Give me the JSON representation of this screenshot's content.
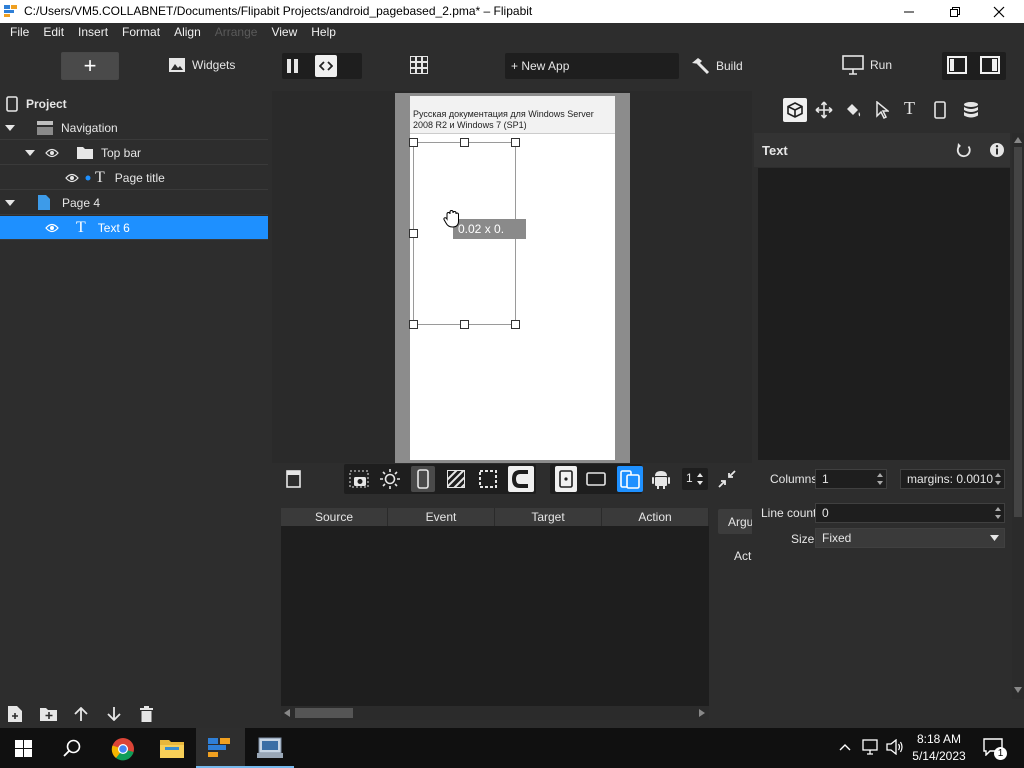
{
  "window": {
    "title": "C:/Users/VM5.COLLABNET/Documents/Flipabit Projects/android_pagebased_2.pma* – Flipabit"
  },
  "menu": [
    "File",
    "Edit",
    "Insert",
    "Format",
    "Align",
    "Arrange",
    "View",
    "Help"
  ],
  "menu_disabled": [
    "Arrange"
  ],
  "toolbar": {
    "add_label": "+",
    "widgets_label": "Widgets",
    "new_app_label": "+ New App",
    "build_label": "Build",
    "run_label": "Run"
  },
  "tree": {
    "header": "Project",
    "items": [
      {
        "label": "Navigation",
        "icon": "navigation-icon"
      },
      {
        "label": "Top bar",
        "icon": "folder-icon"
      },
      {
        "label": "Page title",
        "icon": "text-icon"
      },
      {
        "label": "Page 4",
        "icon": "page-icon"
      },
      {
        "label": "Text 6",
        "icon": "text-icon"
      }
    ]
  },
  "canvas": {
    "topbar_text": "Русская документация для Windows Server 2008 R2 и Windows 7 (SP1)",
    "size_tooltip": "0.02 x 0.",
    "spin_value": "1"
  },
  "events": {
    "columns": [
      "Source",
      "Event",
      "Target",
      "Action"
    ],
    "side_tab": "Argu",
    "side_label": "Act"
  },
  "properties": {
    "title": "Text",
    "columns_label": "Columns",
    "columns_value": "1",
    "margins_value": "margins: 0.0010",
    "line_count_label": "Line count",
    "line_count_value": "0",
    "size_label": "Size",
    "size_value": "Fixed"
  },
  "taskbar": {
    "time": "8:18 AM",
    "date": "5/14/2023",
    "notif_count": "1"
  },
  "colors": {
    "accent": "#1e90ff",
    "panel": "#2d2d2d",
    "dark": "#1e1e1e"
  }
}
